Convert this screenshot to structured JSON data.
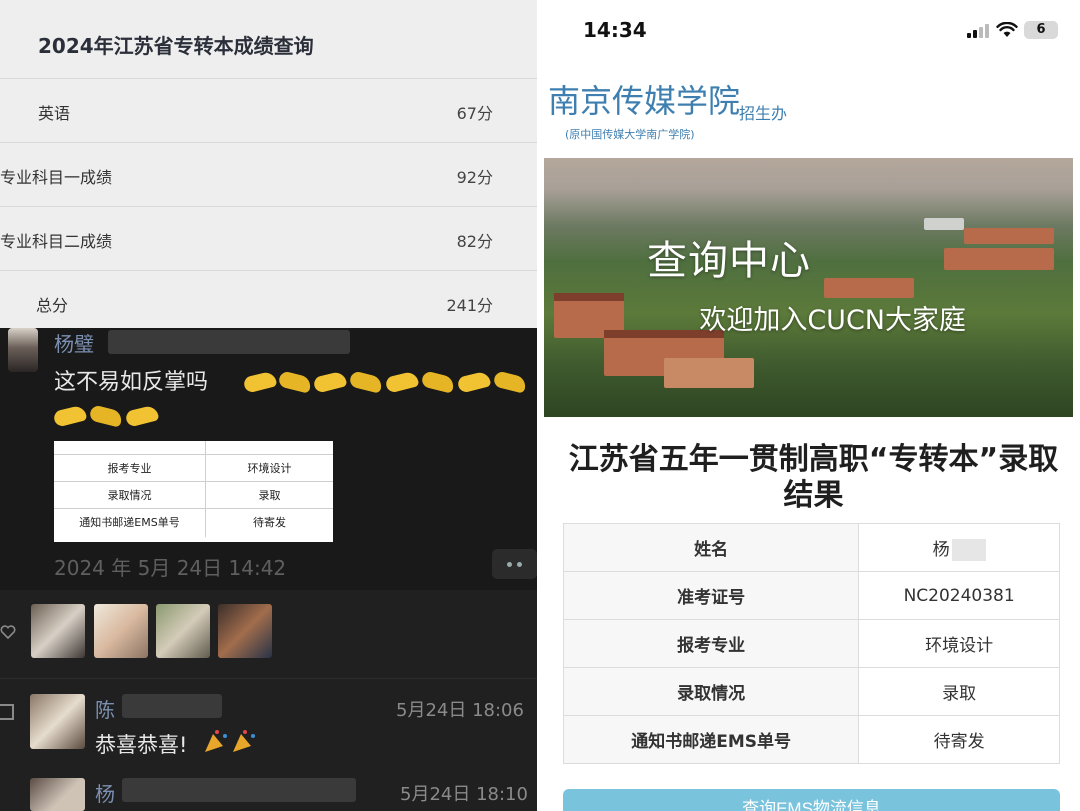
{
  "score_card": {
    "title": "2024年江苏省专转本成绩查询",
    "rows": [
      {
        "label": "英语",
        "value": "67分"
      },
      {
        "label": "专业科目一成绩",
        "value": "92分"
      },
      {
        "label": "专业科目二成绩",
        "value": "82分"
      },
      {
        "label": "总分",
        "value": "241分"
      }
    ]
  },
  "post": {
    "author": "杨璧",
    "text": "这不易如反掌吗",
    "emoji_icon": "raised-hands-emoji",
    "image_table": [
      {
        "key": "报考专业",
        "value": "环境设计"
      },
      {
        "key": "录取情况",
        "value": "录取"
      },
      {
        "key": "通知书邮递EMS单号",
        "value": "待寄发"
      }
    ],
    "time": "2024 年 5月 24日 14:42"
  },
  "comments": [
    {
      "name": "陈",
      "time": "5月24日 18:06",
      "text": "恭喜恭喜!"
    },
    {
      "name": "杨",
      "time": "5月24日 18:10",
      "text": ""
    }
  ],
  "phone": {
    "clock": "14:34",
    "battery": "6"
  },
  "school": {
    "name": "南京传媒学院",
    "dept": "招生办",
    "sub": "(原中国传媒大学南广学院)"
  },
  "banner": {
    "title": "查询中心",
    "subtitle": "欢迎加入CUCN大家庭"
  },
  "result": {
    "title": "江苏省五年一贯制高职“专转本”录取结果",
    "rows": [
      {
        "key": "姓名",
        "value": "杨"
      },
      {
        "key": "准考证号",
        "value": "NC20240381"
      },
      {
        "key": "报考专业",
        "value": "环境设计"
      },
      {
        "key": "录取情况",
        "value": "录取"
      },
      {
        "key": "通知书邮递EMS单号",
        "value": "待寄发"
      }
    ]
  },
  "ems_button": "查询EMS物流信息",
  "colors": {
    "link_blue": "#3f7fb0",
    "nickname": "#7b8fb0",
    "button_blue": "#79c3dd"
  }
}
